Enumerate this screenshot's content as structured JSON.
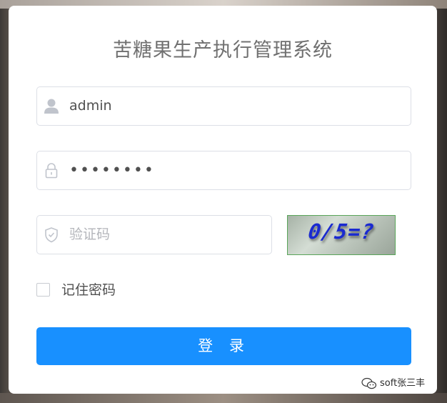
{
  "title": "苦糖果生产执行管理系统",
  "username": {
    "value": "admin",
    "icon": "user-icon"
  },
  "password": {
    "value": "••••••••",
    "icon": "lock-icon"
  },
  "captcha_field": {
    "placeholder": "验证码",
    "icon": "shield-icon"
  },
  "captcha_image": {
    "text": "0/5=?"
  },
  "remember": {
    "label": "记住密码",
    "checked": false
  },
  "login_button": {
    "label": "登 录"
  },
  "watermark": {
    "text": "soft张三丰",
    "icon": "wechat-icon"
  },
  "colors": {
    "primary": "#1890ff",
    "title": "#707070",
    "border": "#dcdfe6",
    "placeholder": "#b4b6bb",
    "captcha_text": "#1a2ad0"
  }
}
